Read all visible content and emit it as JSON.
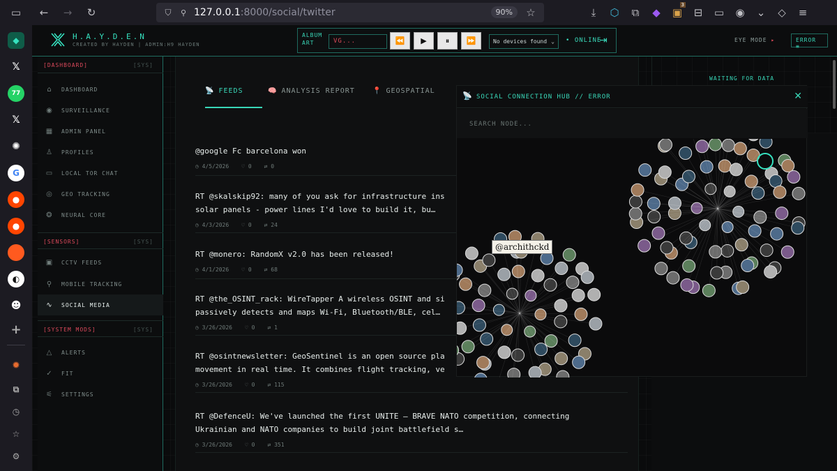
{
  "browser": {
    "url_host": "127.0.0.1",
    "url_path": ":8000/social/twitter",
    "zoom": "90%",
    "sidebar_badges": {
      "whatsapp": "77"
    },
    "extension_badge": "3"
  },
  "header": {
    "logo_title": "H.A.Y.D.E.N",
    "logo_subtitle": "CREATED BY HAYDEN | ADMIN:H9 HAYDEN",
    "album_label": "ALBUM ART",
    "album_value": "VG...",
    "devices": "No devices found",
    "status": "ONLINE",
    "eye_mode": "EYE MODE",
    "error_label": "ERROR"
  },
  "nav": {
    "sections": [
      {
        "name": "[DASHBOARD]",
        "tag": "[SYS]"
      },
      {
        "name": "[SENSORS]",
        "tag": "[SYS]"
      },
      {
        "name": "[SYSTEM MODS]",
        "tag": "[SYS]"
      }
    ],
    "items": [
      {
        "label": "DASHBOARD",
        "icon": "home-icon"
      },
      {
        "label": "SURVEILLANCE",
        "icon": "eye-icon"
      },
      {
        "label": "ADMIN PANEL",
        "icon": "grid-icon"
      },
      {
        "label": "PROFILES",
        "icon": "user-icon"
      },
      {
        "label": "LOCAL TOR CHAT",
        "icon": "chat-icon"
      },
      {
        "label": "GEO TRACKING",
        "icon": "map-pin-icon"
      },
      {
        "label": "NEURAL CORE",
        "icon": "brain-icon"
      },
      {
        "label": "CCTV FEEDS",
        "icon": "camera-icon"
      },
      {
        "label": "MOBILE TRACKING",
        "icon": "search-icon"
      },
      {
        "label": "SOCIAL MEDIA",
        "icon": "activity-icon"
      },
      {
        "label": "ALERTS",
        "icon": "alert-icon"
      },
      {
        "label": "FIT",
        "icon": "check-circle-icon"
      },
      {
        "label": "SETTINGS",
        "icon": "sliders-icon"
      }
    ]
  },
  "tabs": [
    {
      "label": "FEEDS",
      "icon": "📡"
    },
    {
      "label": "ANALYSIS REPORT",
      "icon": "🧠"
    },
    {
      "label": "GEOSPATIAL",
      "icon": "📍"
    }
  ],
  "posts": [
    {
      "text": "@google Fc barcelona won",
      "date": "4/5/2026",
      "likes": "0",
      "retweets": "0"
    },
    {
      "text": "RT @skalskip92: many of you ask for infrastructure ins\nsolar panels - power lines I'd love to build it, bu…",
      "date": "4/3/2026",
      "likes": "0",
      "retweets": "24"
    },
    {
      "text": "RT @monero: RandomX v2.0 has been released!",
      "date": "4/1/2026",
      "likes": "0",
      "retweets": "68"
    },
    {
      "text": "RT @the_OSINT_rack: WireTapper A wireless OSINT and si\npassively detects and maps Wi-Fi, Bluetooth/BLE, cel…",
      "date": "3/26/2026",
      "likes": "0",
      "retweets": "1"
    },
    {
      "text": "RT @osintnewsletter: GeoSentinel is an open source pla\nmovement in real time. It combines flight tracking, ve",
      "date": "3/26/2026",
      "likes": "0",
      "retweets": "115"
    },
    {
      "text": "RT @DefenceU: We've launched the first UNITE – BRAVE NATO competition, connecting\nUkrainian and NATO companies to build joint battlefield s…",
      "date": "3/26/2026",
      "likes": "0",
      "retweets": "351"
    }
  ],
  "right_panel": {
    "waiting": "WAITING FOR DATA"
  },
  "hub": {
    "title": "SOCIAL CONNECTION HUB // ERROR",
    "search_placeholder": "SEARCH NODE...",
    "tooltip": "@archithckd"
  },
  "colors": {
    "accent": "#39d7b8",
    "danger": "#d9485a",
    "bg": "#0a0b0c"
  }
}
